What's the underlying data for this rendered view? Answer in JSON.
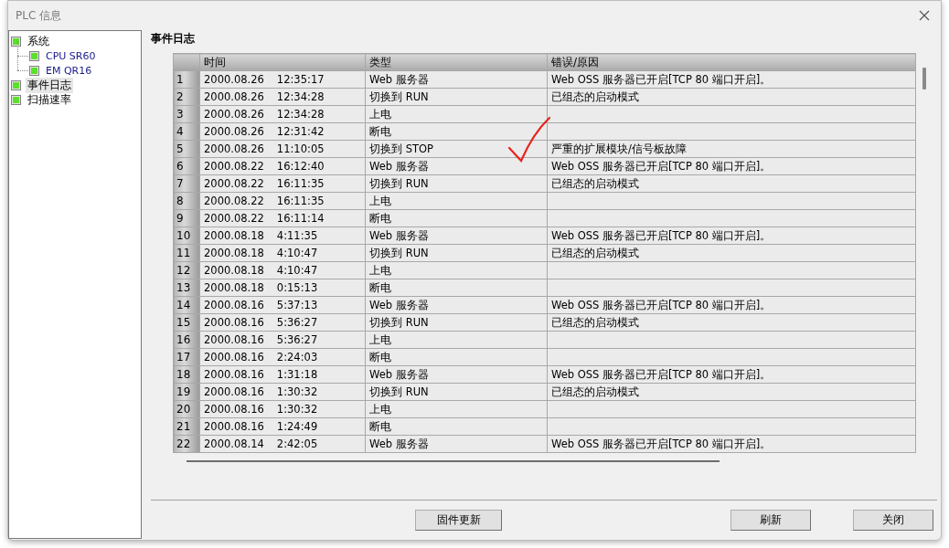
{
  "window": {
    "title": "PLC 信息"
  },
  "tree": [
    {
      "label": "系统",
      "selected": false,
      "children": [
        {
          "label": "CPU SR60",
          "selected": false
        },
        {
          "label": "EM QR16",
          "selected": false
        }
      ]
    },
    {
      "label": "事件日志",
      "selected": true
    },
    {
      "label": "扫描速率",
      "selected": false
    }
  ],
  "section_title": "事件日志",
  "table": {
    "columns": [
      "时间",
      "类型",
      "错误/原因"
    ],
    "rows": [
      {
        "index": "1",
        "date": "2000.08.26",
        "time": "12:35:17",
        "type": "Web 服务器",
        "reason": "Web OSS 服务器已开启[TCP 80 端口开启]。"
      },
      {
        "index": "2",
        "date": "2000.08.26",
        "time": "12:34:28",
        "type": "切换到 RUN",
        "reason": "已组态的启动模式"
      },
      {
        "index": "3",
        "date": "2000.08.26",
        "time": "12:34:28",
        "type": "上电"
      },
      {
        "index": "4",
        "date": "2000.08.26",
        "time": "12:31:42",
        "type": "断电"
      },
      {
        "index": "5",
        "date": "2000.08.26",
        "time": "11:10:05",
        "type": "切换到 STOP",
        "reason": "严重的扩展模块/信号板故障"
      },
      {
        "index": "6",
        "date": "2000.08.22",
        "time": "16:12:40",
        "type": "Web 服务器",
        "reason": "Web OSS 服务器已开启[TCP 80 端口开启]。"
      },
      {
        "index": "7",
        "date": "2000.08.22",
        "time": "16:11:35",
        "type": "切换到 RUN",
        "reason": "已组态的启动模式"
      },
      {
        "index": "8",
        "date": "2000.08.22",
        "time": "16:11:35",
        "type": "上电"
      },
      {
        "index": "9",
        "date": "2000.08.22",
        "time": "16:11:14",
        "type": "断电"
      },
      {
        "index": "10",
        "date": "2000.08.18",
        "time": "4:11:35",
        "type": "Web 服务器",
        "reason": "Web OSS 服务器已开启[TCP 80 端口开启]。"
      },
      {
        "index": "11",
        "date": "2000.08.18",
        "time": "4:10:47",
        "type": "切换到 RUN",
        "reason": "已组态的启动模式"
      },
      {
        "index": "12",
        "date": "2000.08.18",
        "time": "4:10:47",
        "type": "上电"
      },
      {
        "index": "13",
        "date": "2000.08.18",
        "time": "0:15:13",
        "type": "断电"
      },
      {
        "index": "14",
        "date": "2000.08.16",
        "time": "5:37:13",
        "type": "Web 服务器",
        "reason": "Web OSS 服务器已开启[TCP 80 端口开启]。"
      },
      {
        "index": "15",
        "date": "2000.08.16",
        "time": "5:36:27",
        "type": "切换到 RUN",
        "reason": "已组态的启动模式"
      },
      {
        "index": "16",
        "date": "2000.08.16",
        "time": "5:36:27",
        "type": "上电"
      },
      {
        "index": "17",
        "date": "2000.08.16",
        "time": "2:24:03",
        "type": "断电"
      },
      {
        "index": "18",
        "date": "2000.08.16",
        "time": "1:31:18",
        "type": "Web 服务器",
        "reason": "Web OSS 服务器已开启[TCP 80 端口开启]。"
      },
      {
        "index": "19",
        "date": "2000.08.16",
        "time": "1:30:32",
        "type": "切换到 RUN",
        "reason": "已组态的启动模式"
      },
      {
        "index": "20",
        "date": "2000.08.16",
        "time": "1:30:32",
        "type": "上电"
      },
      {
        "index": "21",
        "date": "2000.08.16",
        "time": "1:24:49",
        "type": "断电"
      },
      {
        "index": "22",
        "date": "2000.08.14",
        "time": "2:42:05",
        "type": "Web 服务器",
        "reason": "Web OSS 服务器已开启[TCP 80 端口开启]。"
      }
    ]
  },
  "buttons": [
    "固件更新",
    "刷新",
    "关闭"
  ]
}
